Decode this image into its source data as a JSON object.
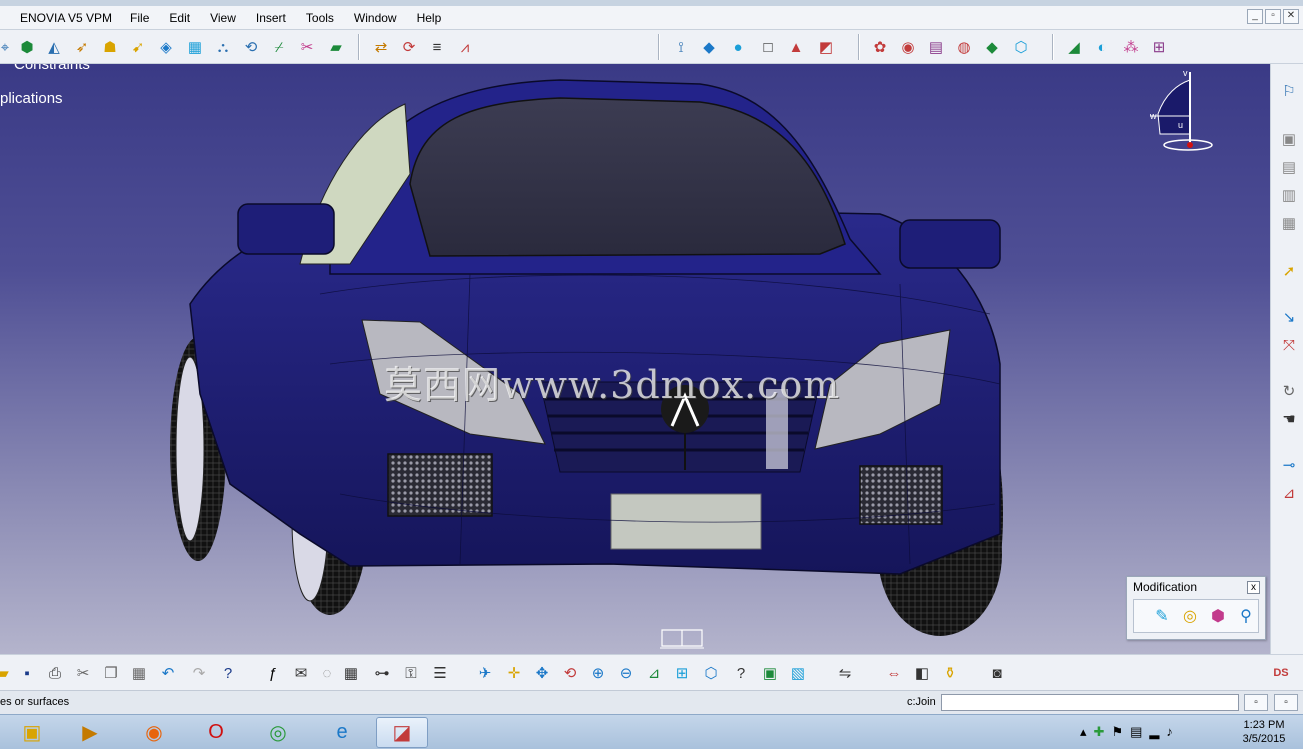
{
  "menubar": {
    "app_name": "ENOVIA V5 VPM",
    "items": [
      {
        "label": "File"
      },
      {
        "label": "Edit"
      },
      {
        "label": "View"
      },
      {
        "label": "Insert"
      },
      {
        "label": "Tools"
      },
      {
        "label": "Window"
      },
      {
        "label": "Help"
      }
    ]
  },
  "window_controls": {
    "minimize": "_",
    "restore": "▫",
    "close": "✕"
  },
  "tree": {
    "item_constraints": "Constraints",
    "item_applications": "plications"
  },
  "viewport": {
    "watermark": "莫西网www.3dmox.com",
    "compass_labels": {
      "v": "v",
      "w": "w",
      "u": "u"
    }
  },
  "modification_panel": {
    "title": "Modification",
    "close": "x"
  },
  "statusbar": {
    "message": "es or surfaces",
    "command_label": "c:Join",
    "command_value": ""
  },
  "taskbar": {
    "time": "1:23 PM",
    "date": "3/5/2015"
  },
  "colors": {
    "viewport_top": "#3a3a86",
    "viewport_bottom": "#b4b4cc",
    "car_body": "#1f1f7a",
    "toolbar_bg": "#eef1f6"
  }
}
